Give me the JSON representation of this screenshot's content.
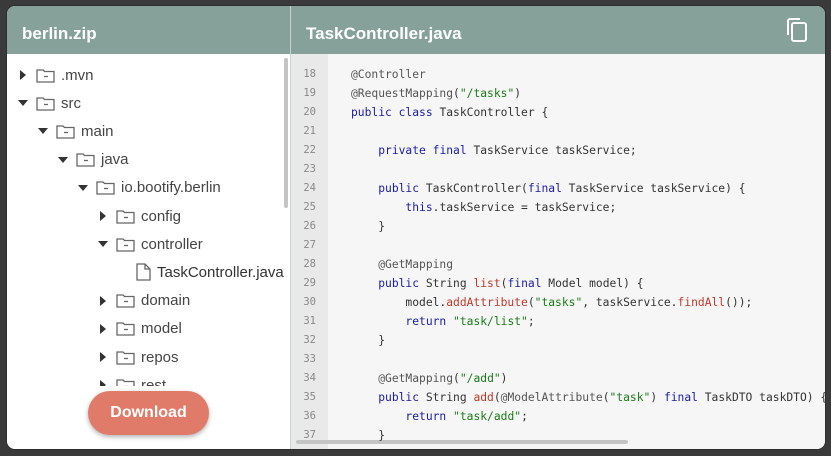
{
  "left_panel": {
    "title": "berlin.zip",
    "download_label": "Download"
  },
  "right_panel": {
    "title": "TaskController.java",
    "copy_icon": "copy-icon"
  },
  "tree": [
    {
      "label": ".mvn",
      "type": "folder",
      "state": "collapsed",
      "depth": 0
    },
    {
      "label": "src",
      "type": "folder",
      "state": "expanded",
      "depth": 0
    },
    {
      "label": "main",
      "type": "folder",
      "state": "expanded",
      "depth": 1
    },
    {
      "label": "java",
      "type": "folder",
      "state": "expanded",
      "depth": 2
    },
    {
      "label": "io.bootify.berlin",
      "type": "folder",
      "state": "expanded",
      "depth": 3
    },
    {
      "label": "config",
      "type": "folder",
      "state": "collapsed",
      "depth": 4
    },
    {
      "label": "controller",
      "type": "folder",
      "state": "expanded",
      "depth": 4
    },
    {
      "label": "TaskController.java",
      "type": "file",
      "state": "selected",
      "depth": 5
    },
    {
      "label": "domain",
      "type": "folder",
      "state": "collapsed",
      "depth": 4
    },
    {
      "label": "model",
      "type": "folder",
      "state": "collapsed",
      "depth": 4
    },
    {
      "label": "repos",
      "type": "folder",
      "state": "collapsed",
      "depth": 4
    },
    {
      "label": "rest",
      "type": "folder",
      "state": "collapsed",
      "depth": 4
    }
  ],
  "code_lines": [
    {
      "n": "18",
      "text": "@Controller"
    },
    {
      "n": "19",
      "text": "@RequestMapping(\"/tasks\")"
    },
    {
      "n": "20",
      "text": "public class TaskController {"
    },
    {
      "n": "21",
      "text": ""
    },
    {
      "n": "22",
      "text": "    private final TaskService taskService;"
    },
    {
      "n": "23",
      "text": ""
    },
    {
      "n": "24",
      "text": "    public TaskController(final TaskService taskService) {"
    },
    {
      "n": "25",
      "text": "        this.taskService = taskService;"
    },
    {
      "n": "26",
      "text": "    }"
    },
    {
      "n": "27",
      "text": ""
    },
    {
      "n": "28",
      "text": "    @GetMapping"
    },
    {
      "n": "29",
      "text": "    public String list(final Model model) {"
    },
    {
      "n": "30",
      "text": "        model.addAttribute(\"tasks\", taskService.findAll());"
    },
    {
      "n": "31",
      "text": "        return \"task/list\";"
    },
    {
      "n": "32",
      "text": "    }"
    },
    {
      "n": "33",
      "text": ""
    },
    {
      "n": "34",
      "text": "    @GetMapping(\"/add\")"
    },
    {
      "n": "35",
      "text": "    public String add(@ModelAttribute(\"task\") final TaskDTO taskDTO) {"
    },
    {
      "n": "36",
      "text": "        return \"task/add\";"
    },
    {
      "n": "37",
      "text": "    }"
    }
  ],
  "colors": {
    "header": "#86a19a",
    "download": "#e07b69",
    "keyword": "#1b1ba8",
    "string": "#1a7a1a",
    "method": "#c0392b"
  }
}
